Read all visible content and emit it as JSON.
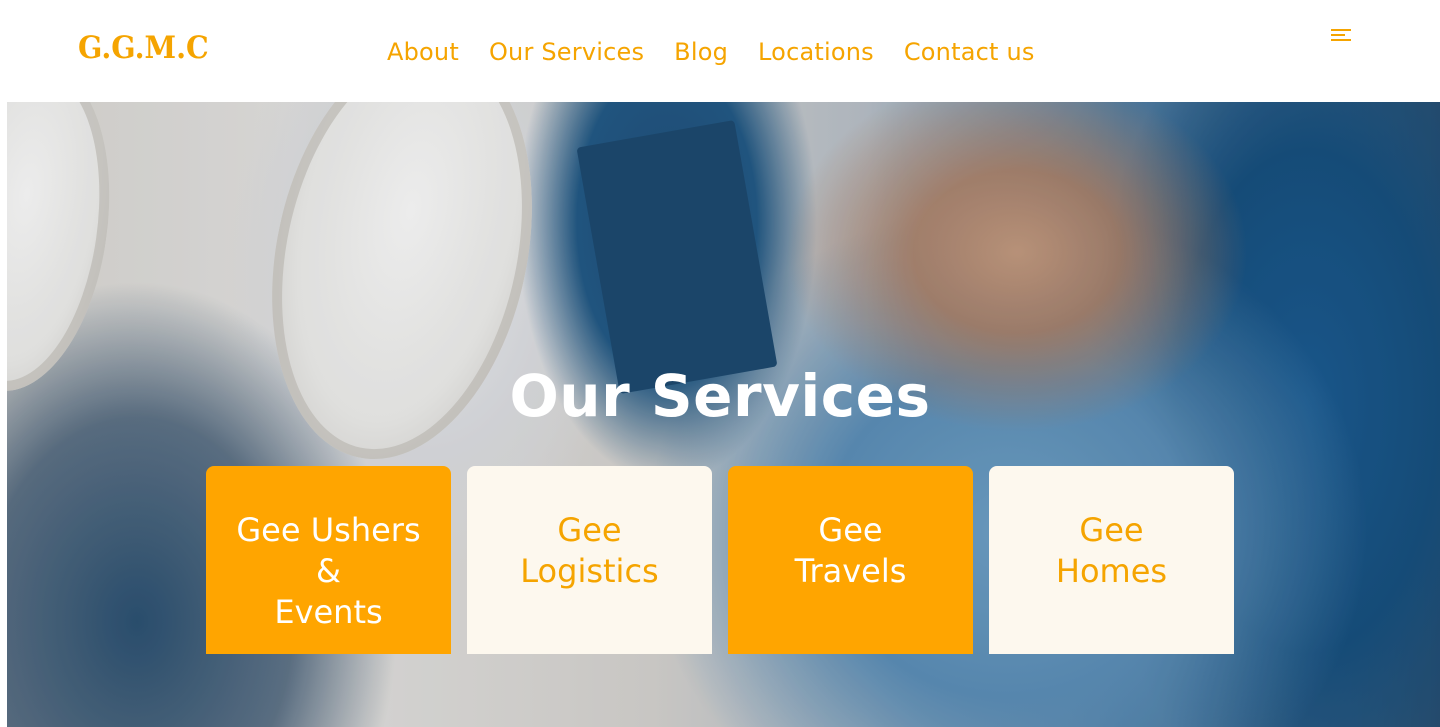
{
  "header": {
    "logo": "G.G.M.C",
    "nav": [
      {
        "label": "About"
      },
      {
        "label": "Our Services"
      },
      {
        "label": "Blog"
      },
      {
        "label": "Locations"
      },
      {
        "label": "Contact us"
      }
    ],
    "menu_icon": "menu-icon"
  },
  "hero": {
    "title": "Our Services",
    "image": "airplane-passenger-reading-photo"
  },
  "services": [
    {
      "label": "Gee Ushers\n&\nEvents",
      "style": "orange"
    },
    {
      "label": "Gee\nLogistics",
      "style": "cream"
    },
    {
      "label": "Gee\nTravels",
      "style": "orange"
    },
    {
      "label": "Gee\nHomes",
      "style": "cream"
    }
  ],
  "colors": {
    "accent": "#FFA500",
    "accent_text": "#F5A400",
    "card_cream": "#FDF8EE",
    "header_bg": "#FFFFFF"
  }
}
